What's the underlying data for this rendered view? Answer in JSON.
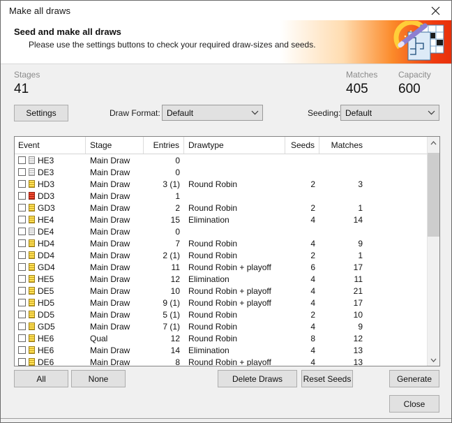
{
  "window": {
    "title": "Make all draws",
    "close_icon": "close-icon"
  },
  "banner": {
    "title": "Seed and make all draws",
    "subtitle": "Please use the settings buttons to check your required draw-sizes and seeds.",
    "art_icon": "draw-wand-icon",
    "accent_color": "#e8300b"
  },
  "stats": [
    {
      "label": "Stages",
      "value": "41"
    },
    {
      "label": "Matches",
      "value": "405"
    },
    {
      "label": "Capacity",
      "value": "600"
    }
  ],
  "controls": {
    "settings_label": "Settings",
    "draw_format_label": "Draw Format:",
    "draw_format_value": "Default",
    "draw_format_options": [
      "Default"
    ],
    "seeding_label": "Seeding:",
    "seeding_value": "Default",
    "seeding_options": [
      "Default"
    ],
    "chevron_icon": "chevron-down-icon"
  },
  "grid": {
    "columns": [
      "Event",
      "Stage",
      "Entries",
      "Drawtype",
      "Seeds",
      "Matches"
    ],
    "rows": [
      {
        "event": "HE3",
        "icon": "draw-icon-gray",
        "stage": "Main Draw",
        "entries": "0",
        "drawtype": "",
        "seeds": "",
        "matches": ""
      },
      {
        "event": "DE3",
        "icon": "draw-icon-gray",
        "stage": "Main Draw",
        "entries": "0",
        "drawtype": "",
        "seeds": "",
        "matches": ""
      },
      {
        "event": "HD3",
        "icon": "draw-icon-yellow",
        "stage": "Main Draw",
        "entries": "3 (1)",
        "drawtype": "Round Robin",
        "seeds": "2",
        "matches": "3"
      },
      {
        "event": "DD3",
        "icon": "draw-icon-red",
        "stage": "Main Draw",
        "entries": "1",
        "drawtype": "",
        "seeds": "",
        "matches": ""
      },
      {
        "event": "GD3",
        "icon": "draw-icon-yellow",
        "stage": "Main Draw",
        "entries": "2",
        "drawtype": "Round Robin",
        "seeds": "2",
        "matches": "1"
      },
      {
        "event": "HE4",
        "icon": "draw-icon-yellow",
        "stage": "Main Draw",
        "entries": "15",
        "drawtype": "Elimination",
        "seeds": "4",
        "matches": "14"
      },
      {
        "event": "DE4",
        "icon": "draw-icon-gray",
        "stage": "Main Draw",
        "entries": "0",
        "drawtype": "",
        "seeds": "",
        "matches": ""
      },
      {
        "event": "HD4",
        "icon": "draw-icon-yellow",
        "stage": "Main Draw",
        "entries": "7",
        "drawtype": "Round Robin",
        "seeds": "4",
        "matches": "9"
      },
      {
        "event": "DD4",
        "icon": "draw-icon-yellow",
        "stage": "Main Draw",
        "entries": "2 (1)",
        "drawtype": "Round Robin",
        "seeds": "2",
        "matches": "1"
      },
      {
        "event": "GD4",
        "icon": "draw-icon-yellow",
        "stage": "Main Draw",
        "entries": "11",
        "drawtype": "Round Robin + playoff",
        "seeds": "6",
        "matches": "17"
      },
      {
        "event": "HE5",
        "icon": "draw-icon-yellow",
        "stage": "Main Draw",
        "entries": "12",
        "drawtype": "Elimination",
        "seeds": "4",
        "matches": "11"
      },
      {
        "event": "DE5",
        "icon": "draw-icon-yellow",
        "stage": "Main Draw",
        "entries": "10",
        "drawtype": "Round Robin + playoff",
        "seeds": "4",
        "matches": "21"
      },
      {
        "event": "HD5",
        "icon": "draw-icon-yellow",
        "stage": "Main Draw",
        "entries": "9 (1)",
        "drawtype": "Round Robin + playoff",
        "seeds": "4",
        "matches": "17"
      },
      {
        "event": "DD5",
        "icon": "draw-icon-yellow",
        "stage": "Main Draw",
        "entries": "5 (1)",
        "drawtype": "Round Robin",
        "seeds": "2",
        "matches": "10"
      },
      {
        "event": "GD5",
        "icon": "draw-icon-yellow",
        "stage": "Main Draw",
        "entries": "7 (1)",
        "drawtype": "Round Robin",
        "seeds": "4",
        "matches": "9"
      },
      {
        "event": "HE6",
        "icon": "draw-icon-yellow",
        "stage": "Qual",
        "entries": "12",
        "drawtype": "Round Robin",
        "seeds": "8",
        "matches": "12"
      },
      {
        "event": "HE6",
        "icon": "draw-icon-yellow",
        "stage": "Main Draw",
        "entries": "14",
        "drawtype": "Elimination",
        "seeds": "4",
        "matches": "13"
      },
      {
        "event": "DE6",
        "icon": "draw-icon-yellow",
        "stage": "Main Draw",
        "entries": "8",
        "drawtype": "Round Robin + playoff",
        "seeds": "4",
        "matches": "13"
      }
    ],
    "scrollbar": {
      "up_icon": "chevron-up-icon",
      "down_icon": "chevron-down-icon"
    }
  },
  "footer": {
    "all_label": "All",
    "none_label": "None",
    "delete_draws_label": "Delete Draws",
    "reset_seeds_label": "Reset Seeds",
    "generate_label": "Generate",
    "close_label": "Close"
  }
}
